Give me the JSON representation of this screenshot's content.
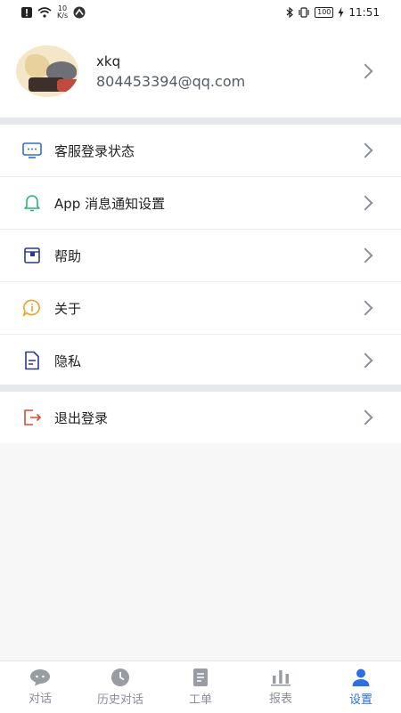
{
  "status_bar": {
    "net_speed_value": "10",
    "net_speed_unit": "K/s",
    "battery": "100",
    "time": "11:51"
  },
  "profile": {
    "username": "xkq",
    "email": "804453394@qq.com"
  },
  "menu_group_1": [
    {
      "label": "客服登录状态",
      "icon": "monitor-icon"
    },
    {
      "label": "App 消息通知设置",
      "icon": "bell-icon"
    },
    {
      "label": "帮助",
      "icon": "help-box-icon"
    },
    {
      "label": "关于",
      "icon": "info-bubble-icon"
    },
    {
      "label": "隐私",
      "icon": "document-icon"
    }
  ],
  "menu_group_2": [
    {
      "label": "退出登录",
      "icon": "logout-icon"
    }
  ],
  "tabs": [
    {
      "label": "对话",
      "icon": "chat-icon",
      "active": false
    },
    {
      "label": "历史对话",
      "icon": "clock-icon",
      "active": false
    },
    {
      "label": "工单",
      "icon": "ticket-icon",
      "active": false
    },
    {
      "label": "报表",
      "icon": "bar-chart-icon",
      "active": false
    },
    {
      "label": "设置",
      "icon": "person-icon",
      "active": true
    }
  ],
  "colors": {
    "accent": "#2a6ee8",
    "logout": "#e0463a",
    "bell": "#2bb673",
    "info": "#f0a020"
  }
}
